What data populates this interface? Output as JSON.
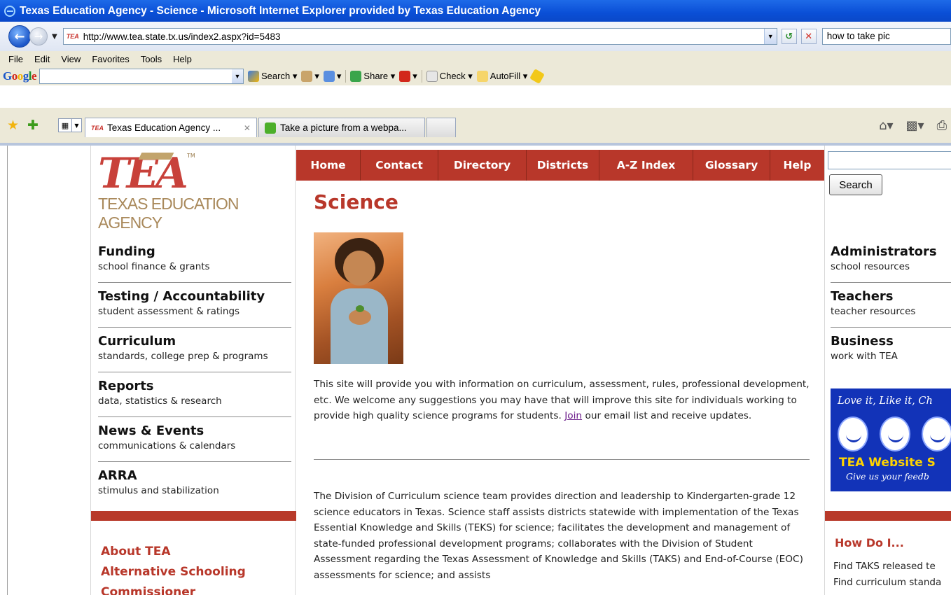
{
  "window": {
    "title": "Texas Education Agency - Science - Microsoft Internet Explorer provided by Texas Education Agency"
  },
  "address_bar": {
    "favicon_text": "TEA",
    "url": "http://www.tea.state.tx.us/index2.aspx?id=5483",
    "search_text": "how to take pic"
  },
  "menu": {
    "items": [
      "File",
      "Edit",
      "View",
      "Favorites",
      "Tools",
      "Help"
    ]
  },
  "google_toolbar": {
    "logo": "Google",
    "search_label": "Search",
    "share_label": "Share",
    "check_label": "Check",
    "autofill_label": "AutoFill"
  },
  "tabs": [
    {
      "label": "Texas Education Agency ...",
      "active": true
    },
    {
      "label": "Take a picture from a webpa...",
      "active": false
    }
  ],
  "site": {
    "logo_mark": "TEA",
    "logo_tm": "TM",
    "logo_name": "TEXAS EDUCATION AGENCY",
    "top_nav": [
      "Home",
      "Contact",
      "Directory",
      "Districts",
      "A-Z Index",
      "Glossary",
      "Help"
    ],
    "left_nav": [
      {
        "title": "Funding",
        "sub": "school finance & grants"
      },
      {
        "title": "Testing / Accountability",
        "sub": "student assessment & ratings"
      },
      {
        "title": "Curriculum",
        "sub": "standards, college prep & programs"
      },
      {
        "title": "Reports",
        "sub": "data, statistics & research"
      },
      {
        "title": "News & Events",
        "sub": "communications & calendars"
      },
      {
        "title": "ARRA",
        "sub": "stimulus and stabilization"
      }
    ],
    "left_links": [
      "About TEA",
      "Alternative Schooling",
      "Commissioner"
    ],
    "page_title": "Science",
    "intro_before_link": "This site will provide you with information on curriculum, assessment, rules, professional development, etc. We welcome any suggestions you may have that will improve this site for individuals working to provide high quality science programs for students. ",
    "intro_link": "Join",
    "intro_after_link": " our email list and receive updates.",
    "division_text": "The Division of Curriculum science team provides direction and leadership to Kindergarten-grade 12 science educators in Texas. Science staff assists districts statewide with implementation of the Texas Essential Knowledge and Skills (TEKS) for science; facilitates the development and management of state-funded professional development programs; collaborates with the Division of Student Assessment regarding the Texas Assessment of Knowledge and Skills (TAKS) and End-of-Course (EOC) assessments for science; and assists",
    "search_button": "Search",
    "right_nav": [
      {
        "title": "Administrators",
        "sub": "school resources"
      },
      {
        "title": "Teachers",
        "sub": "teacher resources"
      },
      {
        "title": "Business",
        "sub": "work with TEA"
      }
    ],
    "banner": {
      "top": "Love it, Like it, Ch",
      "title": "TEA Website S",
      "sub": "Give us your feedb"
    },
    "how_do_title": "How Do I...",
    "how_do_items": [
      "Find TAKS released te",
      "Find curriculum standa"
    ]
  },
  "colors": {
    "brand_red": "#b8372a",
    "logo_tan": "#a9895b",
    "banner_blue": "#1233b8"
  }
}
